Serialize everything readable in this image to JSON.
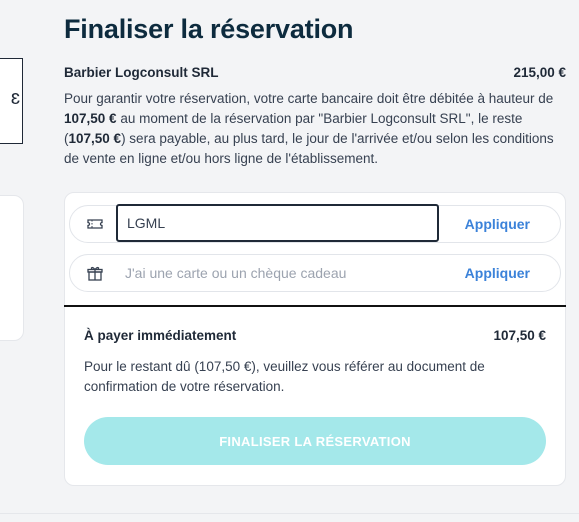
{
  "page": {
    "title": "Finaliser la réservation",
    "left_fragment": "ɛ"
  },
  "merchant": {
    "name": "Barbier Logconsult SRL",
    "total": "215,00 €"
  },
  "description": {
    "p1": "Pour garantir votre réservation, votre carte bancaire doit être débitée à hauteur de ",
    "amount1": "107,50 €",
    "p2": " au moment de la réservation par \"Barbier Logconsult SRL\", le reste (",
    "amount2": "107,50 €",
    "p3": ") sera payable, au plus tard, le jour de l'arrivée et/ou selon les conditions de vente en ligne et/ou hors ligne de l'établissement."
  },
  "promo": {
    "icon": "ticket-icon",
    "value": "LGML",
    "apply_label": "Appliquer"
  },
  "gift": {
    "icon": "gift-icon",
    "placeholder": "J'ai une carte ou un chèque cadeau",
    "apply_label": "Appliquer"
  },
  "payment": {
    "label": "À payer immédiatement",
    "amount": "107,50 €",
    "note": "Pour le restant dû (107,50 €), veuillez vous référer au document de confirmation de votre réservation."
  },
  "finalize_button": "FINALISER LA RÉSERVATION",
  "colors": {
    "accent": "#3b82d9",
    "button_disabled": "#a4e8ea",
    "title": "#0d2b3e"
  }
}
